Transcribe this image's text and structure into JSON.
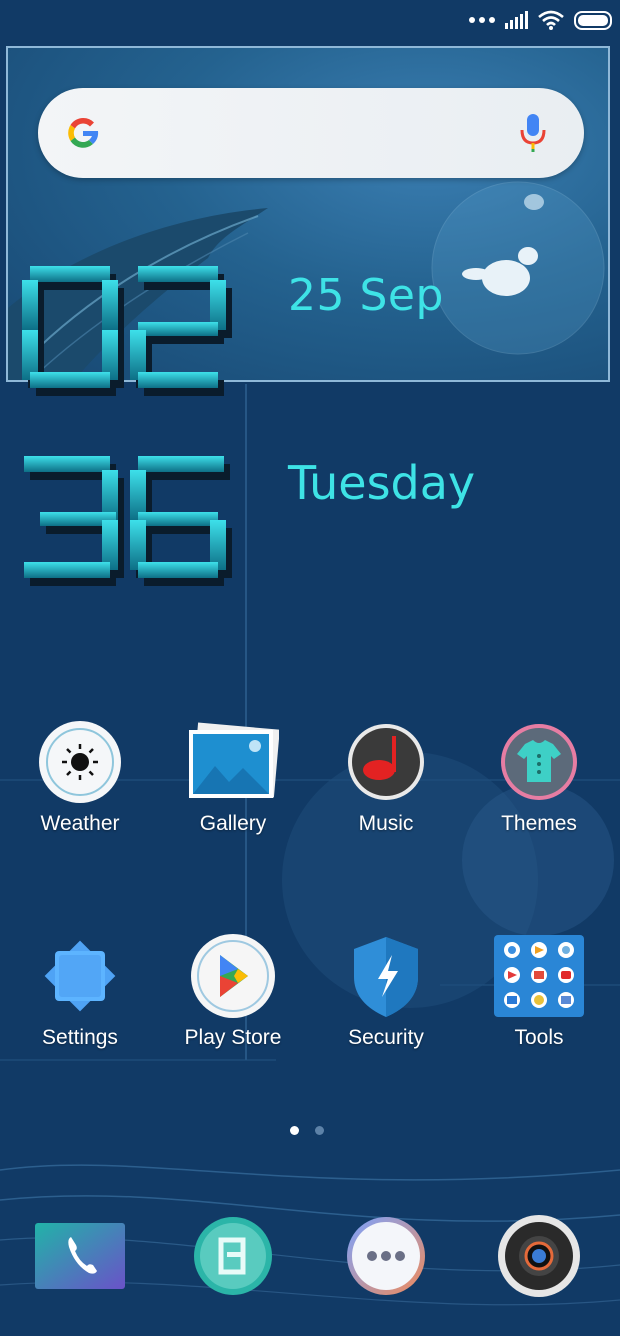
{
  "status_bar": {
    "icons": [
      "more-dots-icon",
      "signal-icon",
      "wifi-icon",
      "battery-icon"
    ]
  },
  "widget": {
    "search_icons": [
      "google-logo-icon",
      "microphone-icon"
    ],
    "clock": {
      "hours": "02",
      "minutes": "36"
    },
    "date": "25 Sep",
    "day": "Tuesday",
    "accent_color": "#3ee3e6"
  },
  "apps": [
    {
      "label": "Weather",
      "icon": "weather-sun-icon"
    },
    {
      "label": "Gallery",
      "icon": "gallery-photos-icon"
    },
    {
      "label": "Music",
      "icon": "music-note-icon"
    },
    {
      "label": "Themes",
      "icon": "themes-shirt-icon"
    },
    {
      "label": "Settings",
      "icon": "settings-icon"
    },
    {
      "label": "Play Store",
      "icon": "play-store-icon"
    },
    {
      "label": "Security",
      "icon": "security-shield-icon"
    },
    {
      "label": "Tools",
      "icon": "tools-folder-icon"
    }
  ],
  "pager": {
    "pages": 2,
    "current": 1
  },
  "dock": [
    {
      "icon": "phone-icon"
    },
    {
      "icon": "messaging-icon"
    },
    {
      "icon": "more-apps-icon"
    },
    {
      "icon": "camera-icon"
    }
  ]
}
